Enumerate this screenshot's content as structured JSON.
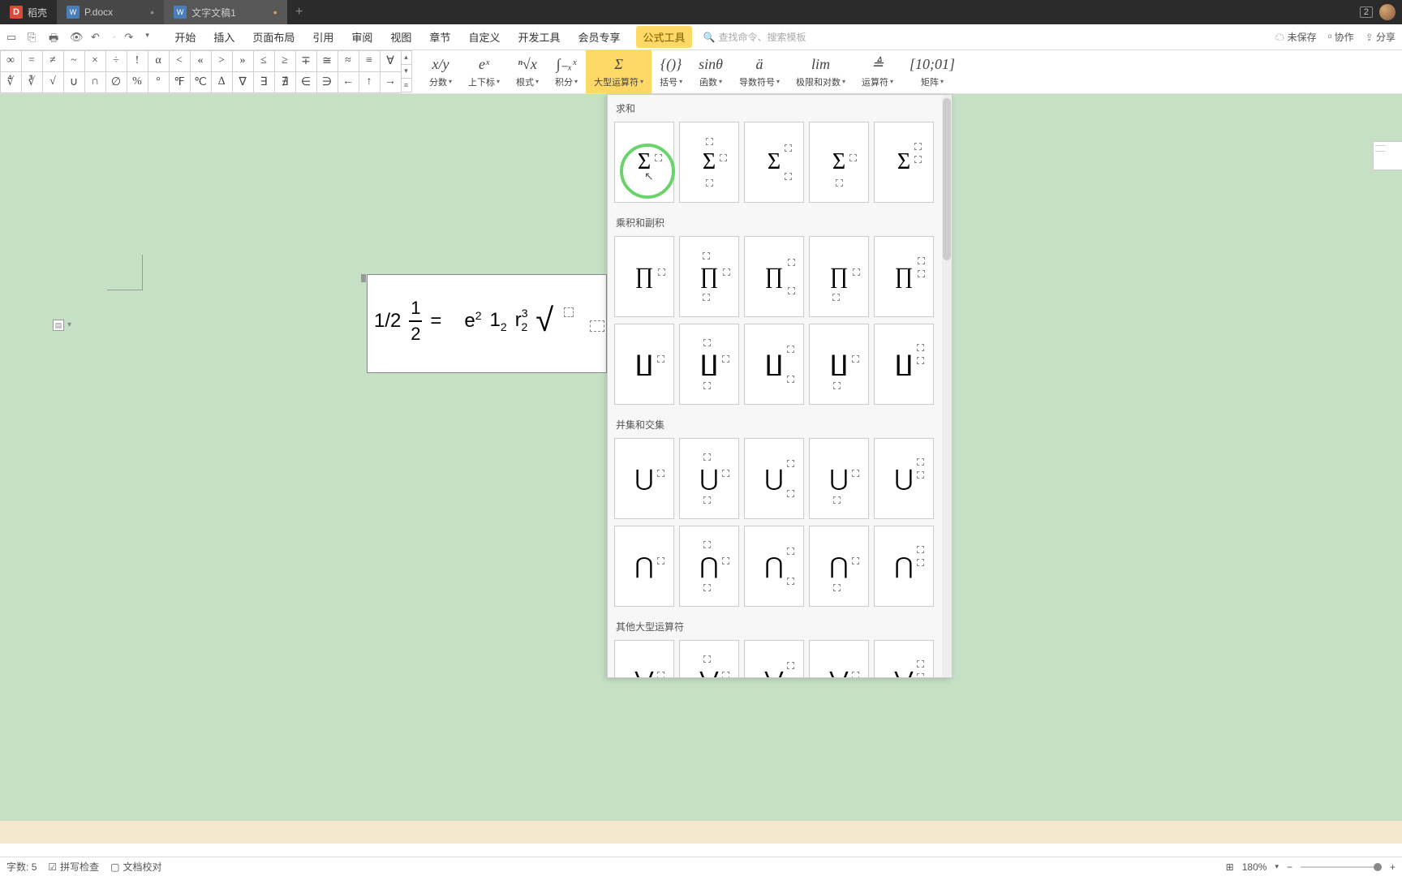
{
  "tabs": [
    {
      "label": "稻壳",
      "logo": "D"
    },
    {
      "label": "P.docx",
      "logo": "W"
    },
    {
      "label": "文字文稿1",
      "logo": "W"
    }
  ],
  "title_badge": "2",
  "quick_icons": [
    "new",
    "open",
    "print",
    "preview",
    "undo",
    "redo",
    "drop"
  ],
  "menus": [
    "开始",
    "插入",
    "页面布局",
    "引用",
    "审阅",
    "视图",
    "章节",
    "自定义",
    "开发工具",
    "会员专享",
    "公式工具"
  ],
  "search_placeholder": "查找命令、搜索模板",
  "status": {
    "unsaved": "未保存",
    "collab": "协作",
    "share": "分享"
  },
  "symbols_row1": [
    "∞",
    "=",
    "≠",
    "~",
    "×",
    "÷",
    "!",
    "α",
    "<",
    "«",
    ">",
    "»",
    "≤",
    "≥",
    "∓",
    "≅",
    "≈",
    "≡",
    "∀"
  ],
  "symbols_row2": [
    "∜",
    "∛",
    "√",
    "∪",
    "∩",
    "∅",
    "%",
    "°",
    "℉",
    "℃",
    "∆",
    "∇",
    "∃",
    "∄",
    "∈",
    "∋",
    "←",
    "↑",
    "→"
  ],
  "formula_groups": [
    {
      "icon": "x/y",
      "label": "分数"
    },
    {
      "icon": "eˣ",
      "label": "上下标"
    },
    {
      "icon": "ⁿ√x",
      "label": "根式"
    },
    {
      "icon": "∫₋ₓˣ",
      "label": "积分"
    },
    {
      "icon": "Σ",
      "label": "大型运算符",
      "active": true
    },
    {
      "icon": "{()}",
      "label": "括号"
    },
    {
      "icon": "sinθ",
      "label": "函数"
    },
    {
      "icon": "ä",
      "label": "导数符号"
    },
    {
      "icon": "lim",
      "label": "极限和对数"
    },
    {
      "icon": "≜",
      "label": "运算符"
    },
    {
      "icon": "[10;01]",
      "label": "矩阵"
    }
  ],
  "equation": {
    "plain_frac": "1/2",
    "frac_num": "1",
    "frac_den": "2",
    "equals": "=",
    "e_sup": "e²",
    "one_sub": "1₂",
    "r_supsub": "r₂³"
  },
  "dropdown": {
    "sections": [
      {
        "title": "求和",
        "symbol": "Σ",
        "variants": 5
      },
      {
        "title": "乘积和副积",
        "rows": [
          {
            "symbol": "∏",
            "variants": 5
          },
          {
            "symbol": "∐",
            "variants": 5
          }
        ]
      },
      {
        "title": "并集和交集",
        "rows": [
          {
            "symbol": "⋃",
            "variants": 5
          },
          {
            "symbol": "⋂",
            "variants": 5
          }
        ]
      },
      {
        "title": "其他大型运算符",
        "rows": [
          {
            "symbol": "⋁",
            "variants": 5
          }
        ]
      }
    ]
  },
  "statusbar": {
    "wordcount_label": "字数:",
    "wordcount": "5",
    "spellcheck": "拼写检查",
    "proof": "文档校对",
    "zoom": "180%"
  },
  "time": "10"
}
